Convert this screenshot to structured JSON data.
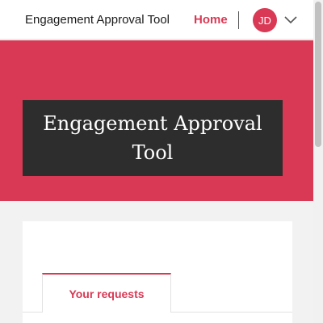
{
  "header": {
    "app_title": "Engagement Approval Tool",
    "nav_home": "Home",
    "user_initials": "JD"
  },
  "hero": {
    "title": "Engagement Approval Tool"
  },
  "card": {
    "tabs": [
      {
        "label": "Your requests",
        "active": true
      }
    ]
  },
  "colors": {
    "accent": "#d93954",
    "hero_box": "#2d2d2d",
    "page_bg": "#f2f2f2"
  },
  "icons": {
    "user_menu": "chevron-down-icon"
  }
}
